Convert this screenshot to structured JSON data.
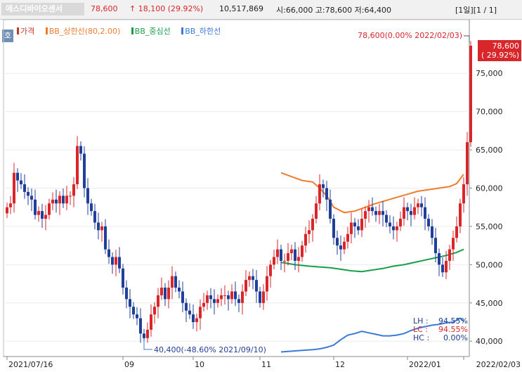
{
  "header": {
    "stock_name": "에스디바이오센서",
    "price": "78,600",
    "change": "↑ 18,100 (29.92%)",
    "volume": "10,517,869",
    "ohl": "시:66,000 고:78,600 저:64,400",
    "period": "[1일][1 / 1]"
  },
  "legend_button": "호",
  "legend": [
    {
      "label": "가격",
      "color": "#c0392b"
    },
    {
      "label": "BB_상한선(80,2.00)",
      "color": "#f07b2e"
    },
    {
      "label": "BB_중심선",
      "color": "#1a9e4a"
    },
    {
      "label": "BB_하한선",
      "color": "#3d79d6"
    }
  ],
  "chart_data": {
    "type": "candlestick",
    "y_ticks": [
      "40,000",
      "45,000",
      "50,000",
      "55,000",
      "60,000",
      "65,000",
      "70,000",
      "75,000"
    ],
    "ylim": [
      38000,
      82000
    ],
    "x_ticks": [
      {
        "label": "2021/07/16",
        "i": 0
      },
      {
        "label": "09",
        "i": 33
      },
      {
        "label": "10",
        "i": 53
      },
      {
        "label": "11",
        "i": 72
      },
      {
        "label": "12",
        "i": 93
      },
      {
        "label": "2022/01",
        "i": 114
      },
      {
        "label": "2022/02/03",
        "i": 130
      }
    ],
    "price_label": "78,600",
    "price_change_label": "( 29.92%)",
    "max_annotation": "78,600(0.00% 2022/02/03)",
    "min_annotation": "40,400(-48.60% 2021/09/10)",
    "bb_stats": [
      {
        "label": "LH :",
        "value": "94.55%"
      },
      {
        "label": "LC :",
        "value": "94.55%"
      },
      {
        "label": "HC :",
        "value": "0.00%"
      }
    ],
    "colors": {
      "up": "#d8262b",
      "down": "#1f3f9a",
      "upper": "#f07b2e",
      "middle": "#1a9e4a",
      "lower": "#3d79d6"
    },
    "close": [
      57500,
      58000,
      62000,
      61000,
      60500,
      59500,
      59000,
      58500,
      56500,
      57000,
      56000,
      56500,
      58000,
      58500,
      58000,
      59000,
      58000,
      59000,
      59000,
      60500,
      65500,
      64500,
      60000,
      58000,
      57000,
      55500,
      54500,
      55000,
      52000,
      51000,
      50000,
      51000,
      49500,
      47000,
      45500,
      44500,
      43500,
      43000,
      41000,
      40400,
      41500,
      43500,
      44500,
      46000,
      47000,
      45500,
      47000,
      48500,
      47000,
      46500,
      45000,
      44000,
      43500,
      42500,
      43000,
      44500,
      45000,
      46000,
      45500,
      45000,
      45500,
      46000,
      46000,
      45500,
      46500,
      45500,
      45000,
      46500,
      48000,
      48500,
      48000,
      46500,
      45000,
      46500,
      48500,
      50000,
      51000,
      52000,
      50500,
      50500,
      51500,
      52000,
      50500,
      51000,
      52500,
      54000,
      54500,
      56000,
      58000,
      60500,
      60000,
      58500,
      56000,
      53500,
      52500,
      52000,
      53000,
      54000,
      55500,
      55000,
      54500,
      56000,
      57000,
      57500,
      57000,
      56500,
      57000,
      56500,
      55500,
      55000,
      54500,
      55000,
      56000,
      57500,
      57000,
      56500,
      57500,
      58000,
      57500,
      56000,
      55000,
      53500,
      51500,
      50000,
      49000,
      50500,
      52000,
      53500,
      55000,
      58000,
      60500,
      66000,
      78600
    ],
    "bb_upper": [
      [
        78,
        62000
      ],
      [
        81,
        61500
      ],
      [
        84,
        61000
      ],
      [
        87,
        60800
      ],
      [
        89,
        60000
      ],
      [
        91,
        59000
      ],
      [
        93,
        57500
      ],
      [
        96,
        56800
      ],
      [
        99,
        57000
      ],
      [
        102,
        57500
      ],
      [
        105,
        58000
      ],
      [
        108,
        58400
      ],
      [
        111,
        58800
      ],
      [
        114,
        59200
      ],
      [
        117,
        59600
      ],
      [
        120,
        59800
      ],
      [
        123,
        60000
      ],
      [
        126,
        60200
      ],
      [
        128,
        60600
      ],
      [
        129,
        61200
      ],
      [
        130,
        61800
      ]
    ],
    "bb_middle": [
      [
        78,
        50300
      ],
      [
        82,
        50000
      ],
      [
        86,
        49800
      ],
      [
        89,
        49700
      ],
      [
        92,
        49600
      ],
      [
        95,
        49400
      ],
      [
        98,
        49200
      ],
      [
        101,
        49100
      ],
      [
        104,
        49300
      ],
      [
        107,
        49500
      ],
      [
        110,
        49800
      ],
      [
        113,
        50000
      ],
      [
        116,
        50300
      ],
      [
        119,
        50600
      ],
      [
        122,
        50900
      ],
      [
        125,
        51200
      ],
      [
        128,
        51600
      ],
      [
        130,
        52000
      ]
    ],
    "bb_lower": [
      [
        78,
        38600
      ],
      [
        81,
        38700
      ],
      [
        84,
        38800
      ],
      [
        87,
        38900
      ],
      [
        89,
        39000
      ],
      [
        91,
        39200
      ],
      [
        93,
        39500
      ],
      [
        95,
        40200
      ],
      [
        97,
        40800
      ],
      [
        99,
        41000
      ],
      [
        101,
        41300
      ],
      [
        103,
        41100
      ],
      [
        105,
        40900
      ],
      [
        107,
        40700
      ],
      [
        109,
        40700
      ],
      [
        111,
        40800
      ],
      [
        113,
        41000
      ],
      [
        115,
        41400
      ],
      [
        117,
        41700
      ],
      [
        119,
        41900
      ],
      [
        121,
        42100
      ],
      [
        123,
        42200
      ],
      [
        125,
        42400
      ],
      [
        127,
        42500
      ],
      [
        129,
        43000
      ],
      [
        130,
        42600
      ]
    ]
  }
}
